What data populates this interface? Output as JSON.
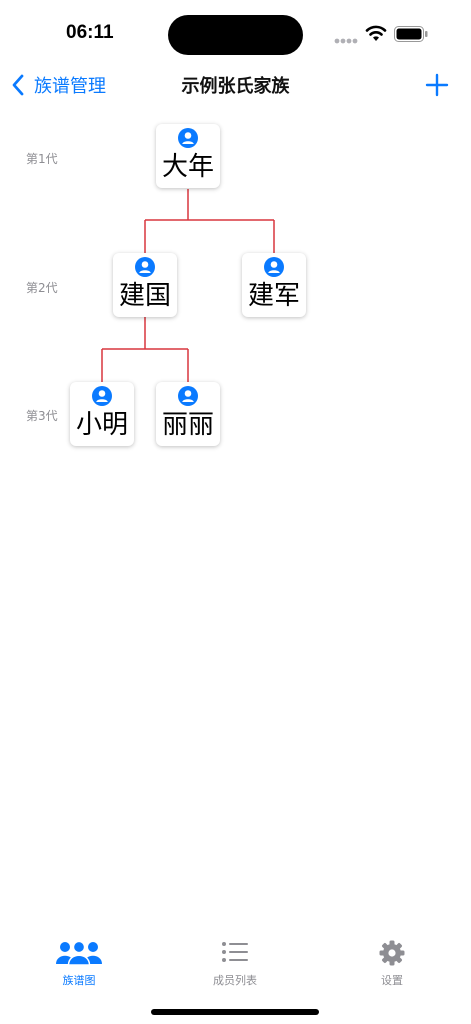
{
  "status_bar": {
    "time": "06:11"
  },
  "nav": {
    "back_label": "族谱管理",
    "title": "示例张氏家族"
  },
  "generations": [
    {
      "label": "第1代"
    },
    {
      "label": "第2代"
    },
    {
      "label": "第3代"
    }
  ],
  "members": [
    {
      "name": "大年"
    },
    {
      "name": "建国"
    },
    {
      "name": "建军"
    },
    {
      "name": "小明"
    },
    {
      "name": "丽丽"
    }
  ],
  "colors": {
    "accent": "#0a7aff",
    "tree_line": "#d9363e",
    "inactive": "#8e8e93"
  },
  "tabs": [
    {
      "label": "族谱图",
      "icon": "people-icon",
      "active": true
    },
    {
      "label": "成员列表",
      "icon": "list-icon",
      "active": false
    },
    {
      "label": "设置",
      "icon": "gear-icon",
      "active": false
    }
  ]
}
